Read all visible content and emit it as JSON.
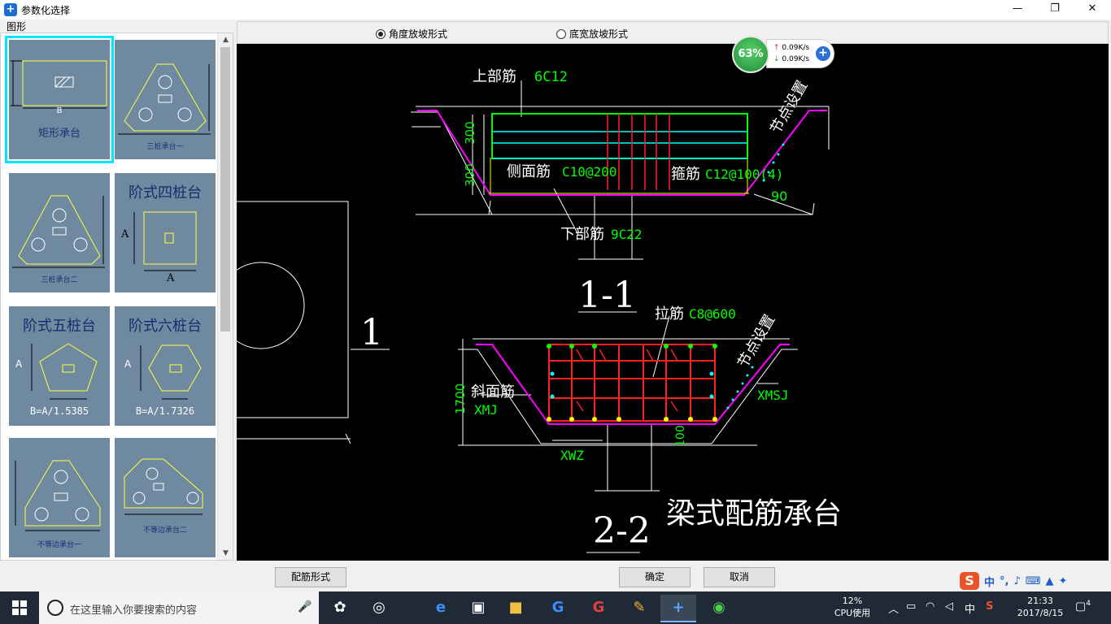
{
  "window": {
    "title": "参数化选择",
    "minimize": "—",
    "maximize": "❐",
    "close": "✕"
  },
  "gallery": {
    "label": "图形",
    "items": [
      {
        "label": "矩形承台",
        "dim": "B",
        "selected": true
      },
      {
        "label": "三桩承台一"
      },
      {
        "label": "三桩承台二"
      },
      {
        "label": "阶式四桩台",
        "dim": "A"
      },
      {
        "label": "阶式五桩台",
        "formula": "B=A/1.5385"
      },
      {
        "label": "阶式六桩台",
        "formula": "B=A/1.7326"
      },
      {
        "label": "不等边承台一"
      },
      {
        "label": "不等边承台二"
      }
    ]
  },
  "options": {
    "radio_angle": "角度放坡形式",
    "radio_width": "底宽放坡形式",
    "selected": "angle"
  },
  "drawing": {
    "s1": {
      "title": "1-1",
      "top_bar_label": "上部筋",
      "top_bar_spec": "6C12",
      "side_label": "侧面筋",
      "side_spec": "C10@200",
      "stirrup_label": "箍筋",
      "stirrup_spec": "C12@100(4)",
      "bottom_label": "下部筋",
      "bottom_spec": "9C22",
      "dim_upper": "300",
      "dim_lower": "300",
      "angle": "90",
      "node_setting": "节点设置"
    },
    "s2": {
      "title": "2-2",
      "tie_label": "拉筋",
      "tie_spec": "C8@600",
      "slope_label": "斜面筋",
      "slope_spec": "XMJ",
      "xmsj": "XMSJ",
      "xwz": "XWZ",
      "height": "1700",
      "dim_100": "100",
      "node_setting": "节点设置"
    },
    "plan_label": "1",
    "caption": "梁式配筋承台"
  },
  "net_widget": {
    "percent": "63%",
    "up": "0.09K/s",
    "down": "0.09K/s"
  },
  "buttons": {
    "rebar_form": "配筋形式",
    "ok": "确定",
    "cancel": "取消"
  },
  "ime": {
    "lang": "中",
    "punct": "°,"
  },
  "taskbar": {
    "search_placeholder": "在这里输入你要搜索的内容",
    "cpu_percent": "12%",
    "cpu_label": "CPU使用",
    "ime_indicator": "中",
    "time": "21:33",
    "date": "2017/8/15",
    "notifications": "4"
  },
  "colors": {
    "canvas_bg": "#000000",
    "gallery_thumb": "#6f8aa0",
    "selection": "#00e5ff",
    "cad_green": "#00ff00",
    "cad_red": "#ff2020",
    "cad_magenta": "#ff00ff",
    "cad_cyan": "#00ffff",
    "cad_yellow": "#ffff00"
  }
}
